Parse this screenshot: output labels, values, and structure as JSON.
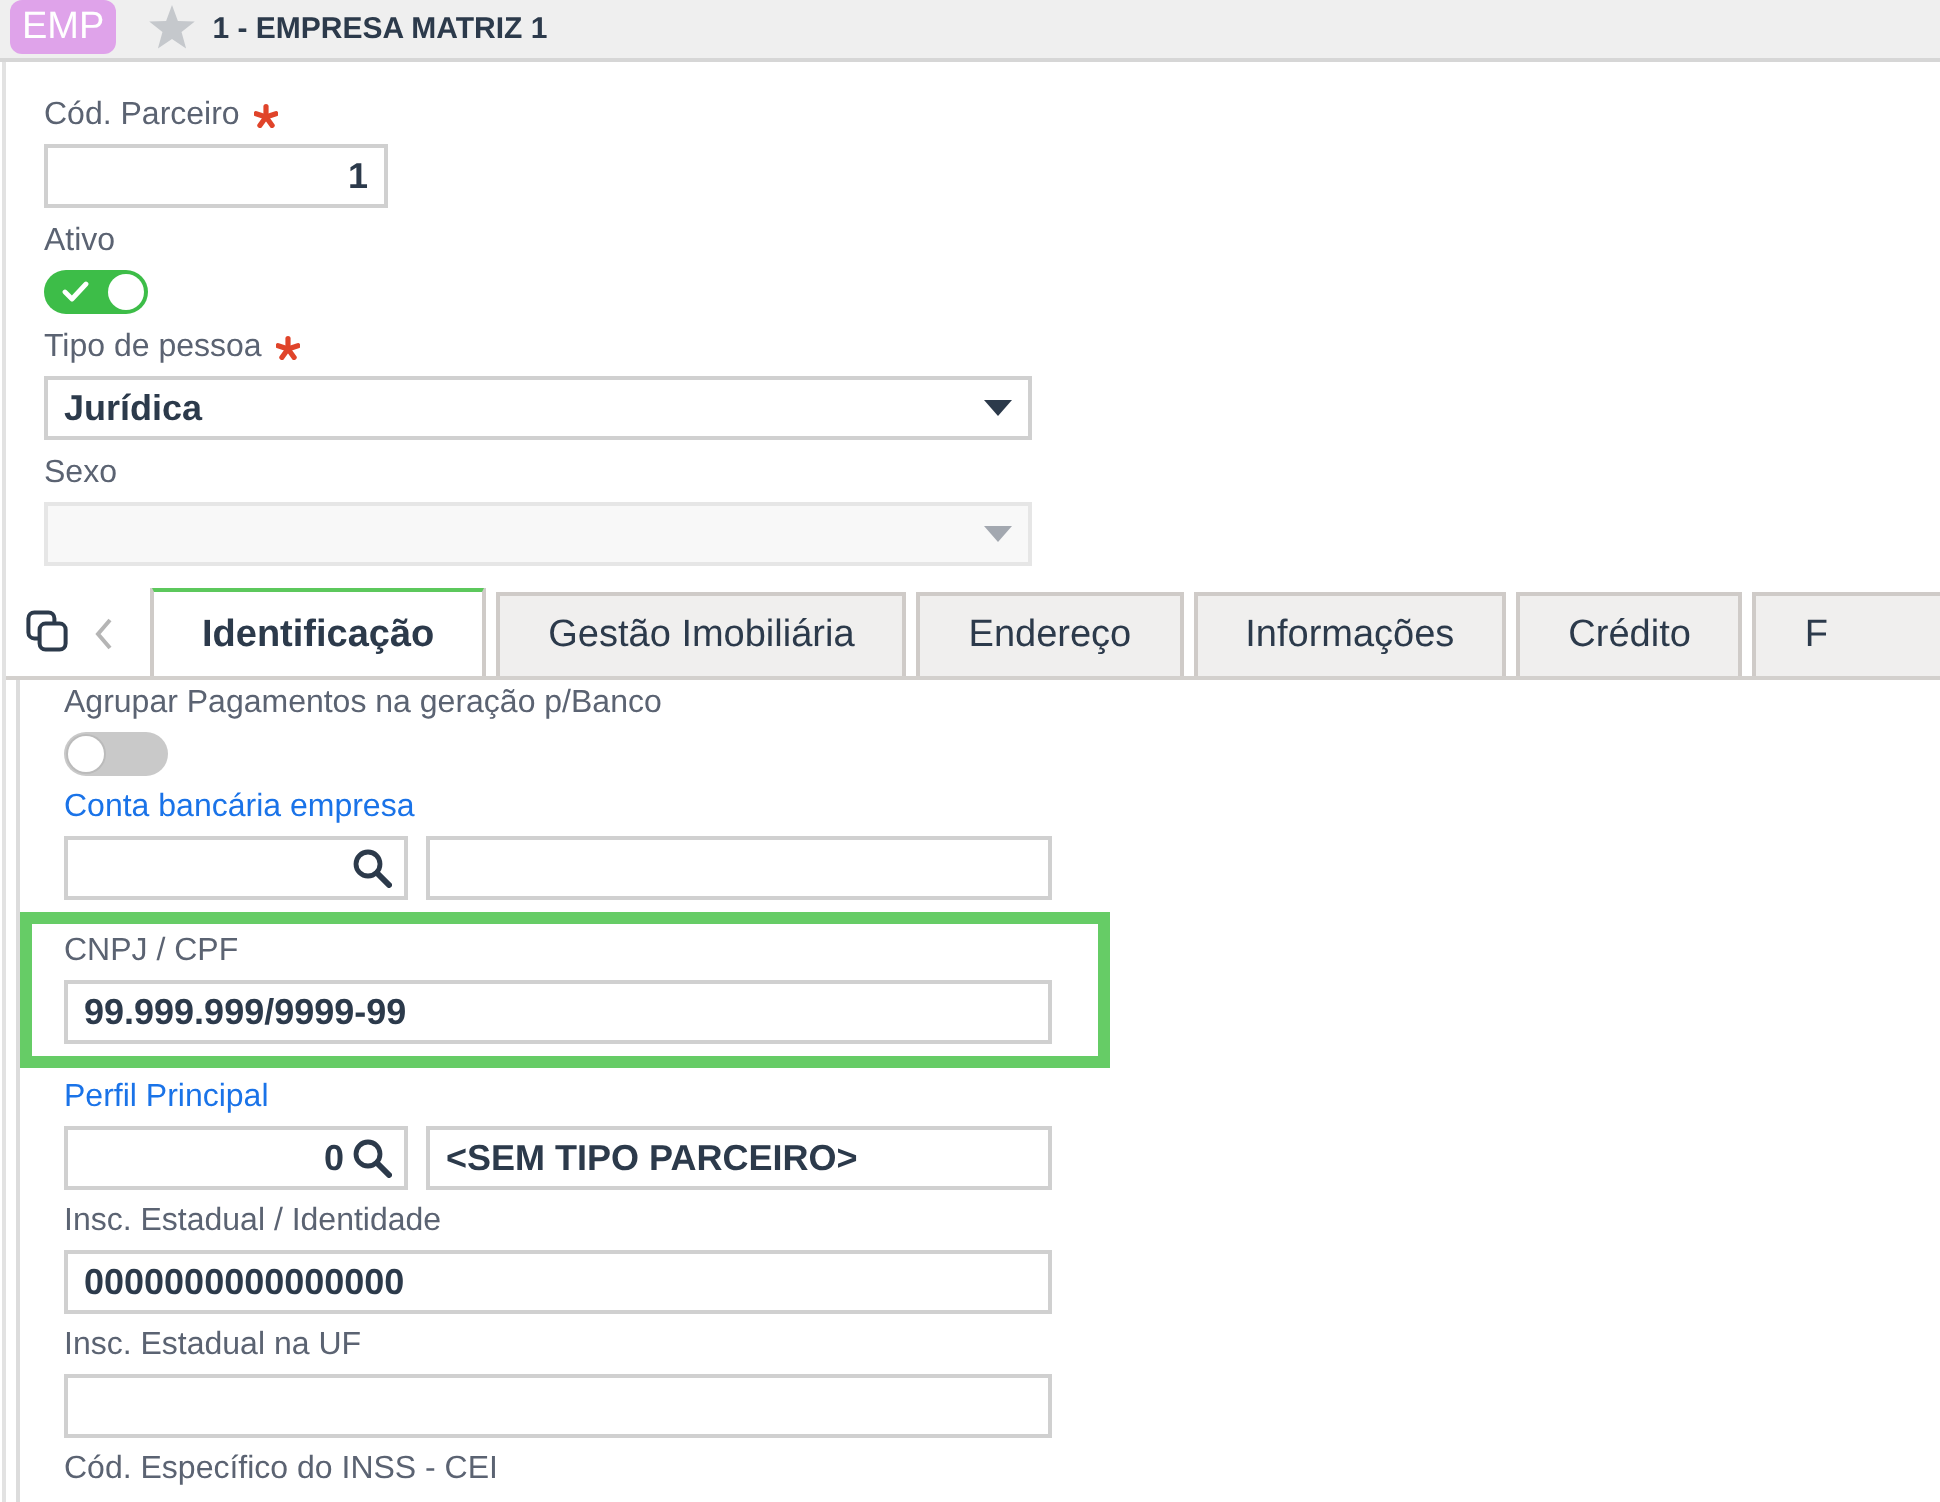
{
  "header": {
    "badge": "EMP",
    "favorite": false,
    "title": "1 - EMPRESA MATRIZ 1"
  },
  "fields": [
    {
      "kind": "number",
      "label": "Cód. Parceiro",
      "required": true,
      "disabled": false,
      "value": "1"
    },
    {
      "kind": "switch",
      "label": "Ativo",
      "required": false,
      "disabled": false,
      "on": true
    },
    {
      "kind": "select",
      "label": "Tipo de pessoa",
      "required": true,
      "disabled": false,
      "value": "Jurídica"
    },
    {
      "kind": "select",
      "label": "Sexo",
      "required": false,
      "disabled": true
    }
  ],
  "tabs": [
    {
      "label": "Identificação",
      "selected": true
    },
    {
      "label": "Gestão Imobiliária",
      "selected": false
    },
    {
      "label": "Endereço",
      "selected": false
    },
    {
      "label": "Informações",
      "selected": false
    },
    {
      "label": "Crédito",
      "selected": false
    },
    {
      "label": "F",
      "selected": false
    }
  ],
  "tab_fields": [
    {
      "kind": "switch",
      "label": "Agrupar Pagamentos na geração p/Banco",
      "highlighted": false,
      "on": false
    },
    {
      "kind": "lookup",
      "label": "Conta bancária empresa",
      "highlighted": false
    },
    {
      "kind": "text",
      "label": "CNPJ / CPF",
      "highlighted": true,
      "value": "99.999.999/9999-99"
    },
    {
      "kind": "lookup",
      "label": "Perfil Principal",
      "highlighted": false,
      "code": "0",
      "description": "<SEM TIPO PARCEIRO>"
    },
    {
      "kind": "text",
      "label": "Insc. Estadual / Identidade",
      "highlighted": false,
      "value": "0000000000000000"
    },
    {
      "kind": "text",
      "label": "Insc. Estadual na UF",
      "highlighted": false
    },
    {
      "kind": "label",
      "label": "Cód. Específico do INSS - CEI",
      "highlighted": false
    }
  ]
}
